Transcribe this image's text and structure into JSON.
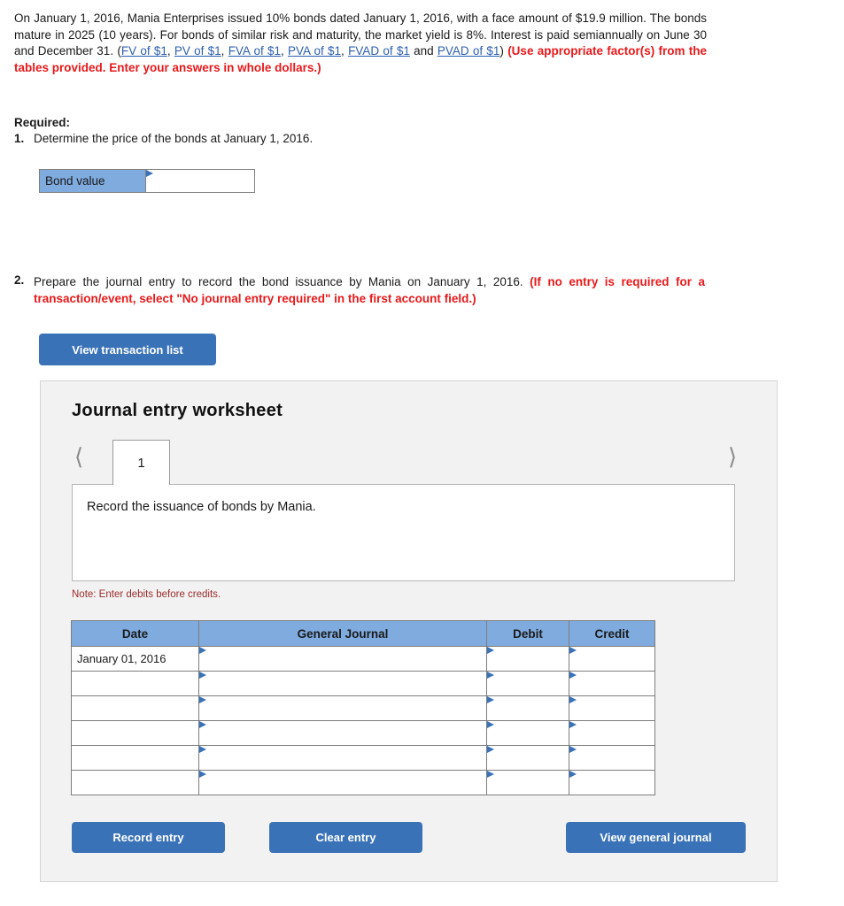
{
  "problem": {
    "text_part1": "On January 1, 2016, Mania Enterprises issued 10% bonds dated January 1, 2016, with a face amount of $19.9 million. The bonds mature in 2025 (10 years). For bonds of similar risk and maturity, the market yield is 8%. Interest is paid semiannually on June 30 and December 31.  (",
    "links": [
      "FV of $1",
      "PV of $1",
      "FVA of $1",
      "PVA of $1",
      "FVAD of $1",
      "PVAD of $1"
    ],
    "link_sep_comma": ", ",
    "link_sep_and": " and ",
    "text_close_paren": ")",
    "instruction_red": "(Use appropriate factor(s) from the tables provided. Enter your answers in whole dollars.)"
  },
  "required": {
    "heading": "Required:",
    "items": [
      {
        "number": "1.",
        "text": "Determine the price of the bonds at January 1, 2016."
      },
      {
        "number": "2.",
        "text": "Prepare the journal entry to record the bond issuance by Mania on January 1, 2016. ",
        "red_note": "(If no entry is required for a transaction/event, select \"No journal entry required\" in the first account field.)"
      }
    ]
  },
  "bond_value": {
    "label": "Bond value",
    "value": "",
    "placeholder": ""
  },
  "buttons": {
    "view_transaction_list": "View transaction list",
    "record_entry": "Record entry",
    "clear_entry": "Clear entry",
    "view_general_journal": "View general journal"
  },
  "worksheet": {
    "title": "Journal entry worksheet",
    "prev_icon": "chevron-left",
    "next_icon": "chevron-right",
    "tabs": [
      {
        "label": "1",
        "active": true
      }
    ],
    "description": "Record the issuance of bonds by Mania.",
    "note": "Note: Enter debits before credits."
  },
  "journal_table": {
    "columns": [
      "Date",
      "General Journal",
      "Debit",
      "Credit"
    ],
    "rows": [
      {
        "date": "January 01, 2016",
        "general_journal": "",
        "debit": "",
        "credit": ""
      },
      {
        "date": "",
        "general_journal": "",
        "debit": "",
        "credit": ""
      },
      {
        "date": "",
        "general_journal": "",
        "debit": "",
        "credit": ""
      },
      {
        "date": "",
        "general_journal": "",
        "debit": "",
        "credit": ""
      },
      {
        "date": "",
        "general_journal": "",
        "debit": "",
        "credit": ""
      },
      {
        "date": "",
        "general_journal": "",
        "debit": "",
        "credit": ""
      }
    ]
  },
  "colors": {
    "header_blue": "#7fabdf",
    "button_blue": "#3a72b8",
    "link_blue": "#2d5faf",
    "red_instruction": "#e8191b",
    "note_red": "#9b2c2c",
    "panel_bg": "#f2f2f2"
  }
}
